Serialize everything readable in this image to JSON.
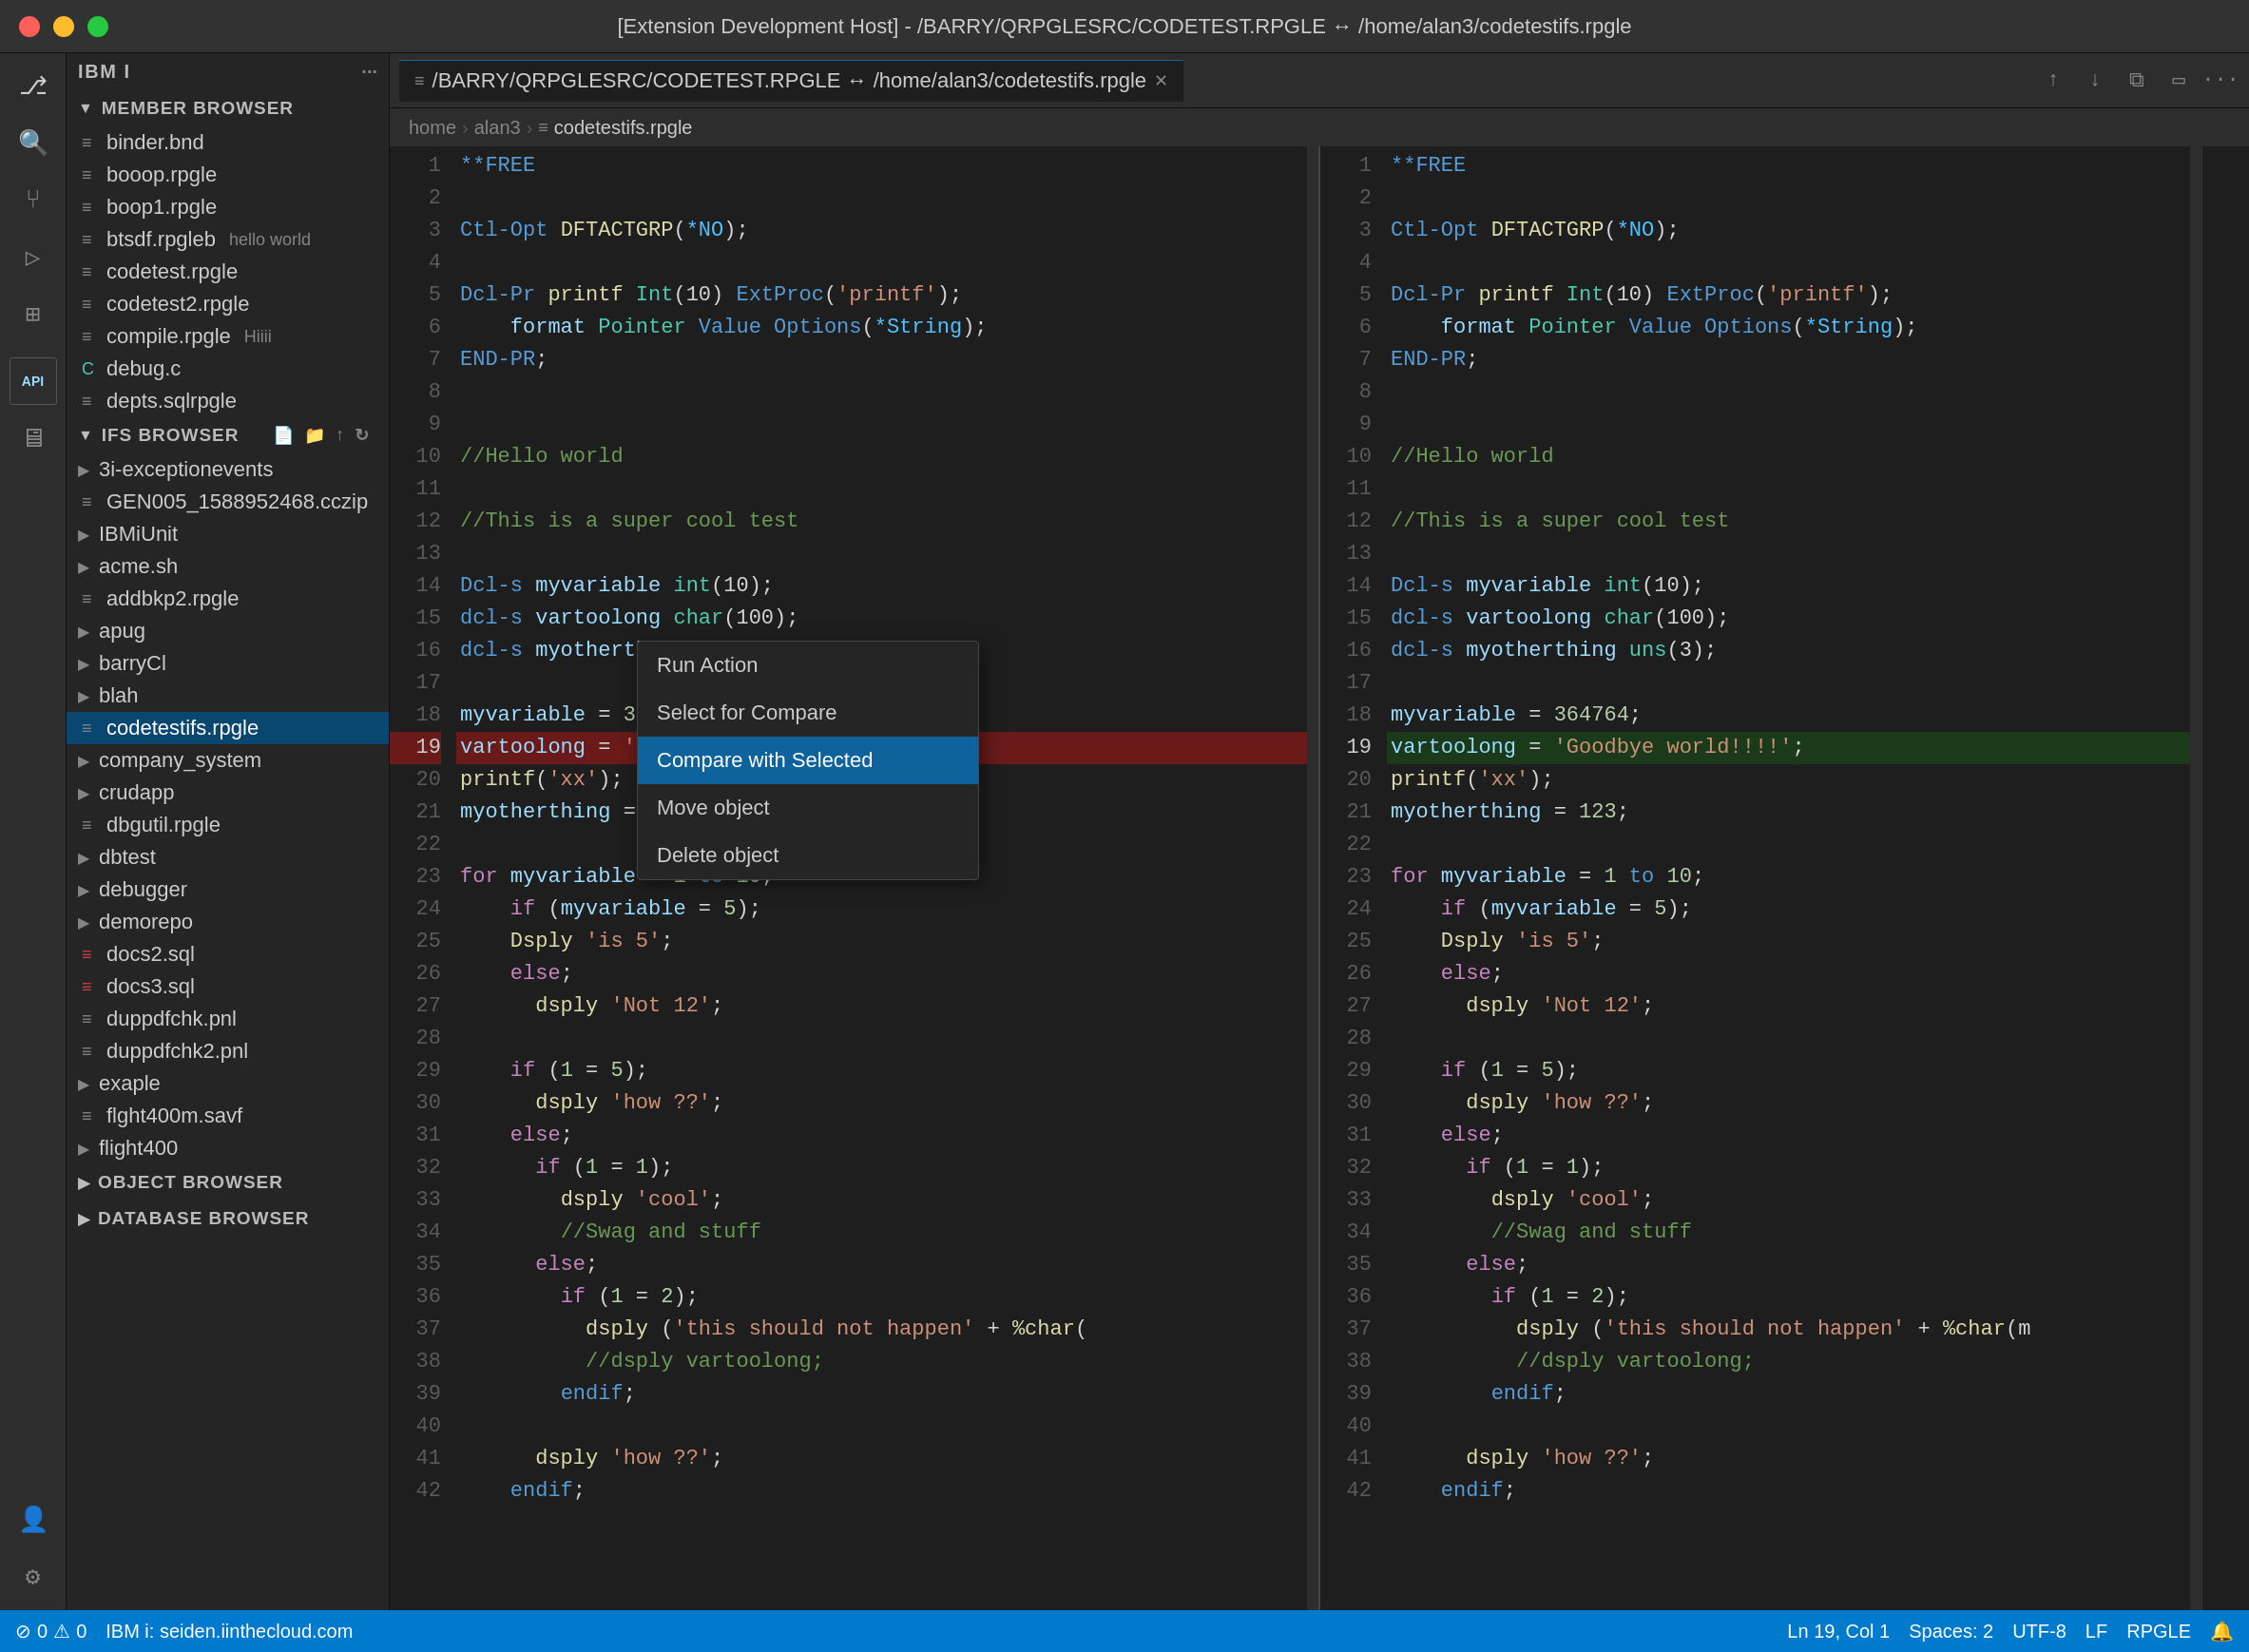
{
  "titleBar": {
    "text": "[Extension Development Host] - /BARRY/QRPGLESRC/CODETEST.RPGLE ↔ /home/alan3/codetestifs.rpgle"
  },
  "sidebar": {
    "topTitle": "IBM I",
    "memberBrowser": {
      "label": "MEMBER BROWSER",
      "items": [
        {
          "name": "binder.bnd",
          "icon": "≡",
          "badge": ""
        },
        {
          "name": "booop.rpgle",
          "icon": "≡",
          "badge": ""
        },
        {
          "name": "boop1.rpgle",
          "icon": "≡",
          "badge": ""
        },
        {
          "name": "btsdf.rpgleb",
          "icon": "≡",
          "badge": "hello world"
        },
        {
          "name": "codetest.rpgle",
          "icon": "≡",
          "badge": ""
        },
        {
          "name": "codetest2.rpgle",
          "icon": "≡",
          "badge": ""
        },
        {
          "name": "compile.rpgle",
          "icon": "≡",
          "badge": "Hiiii"
        },
        {
          "name": "debug.c",
          "icon": "C",
          "badge": ""
        },
        {
          "name": "depts.sqlrpgle",
          "icon": "≡",
          "badge": ""
        }
      ]
    },
    "ifsBrowser": {
      "label": "IFS BROWSER",
      "items": [
        {
          "name": "3i-exceptionevents",
          "icon": "▶",
          "type": "folder"
        },
        {
          "name": "GEN005_1588952468.cczip",
          "icon": "≡",
          "type": "file"
        },
        {
          "name": "IBMiUnit",
          "icon": "▶",
          "type": "folder"
        },
        {
          "name": "acme.sh",
          "icon": "▶",
          "type": "folder"
        },
        {
          "name": "addbkp2.rpgle",
          "icon": "≡",
          "type": "file"
        },
        {
          "name": "apug",
          "icon": "▶",
          "type": "folder"
        },
        {
          "name": "barryCl",
          "icon": "▶",
          "type": "folder"
        },
        {
          "name": "blah",
          "icon": "▶",
          "type": "folder"
        },
        {
          "name": "codetestifs.rpgle",
          "icon": "≡",
          "type": "file",
          "selected": true
        },
        {
          "name": "company_system",
          "icon": "▶",
          "type": "folder"
        },
        {
          "name": "crudapp",
          "icon": "▶",
          "type": "folder"
        },
        {
          "name": "dbgutil.rpgle",
          "icon": "≡",
          "type": "file"
        },
        {
          "name": "dbtest",
          "icon": "▶",
          "type": "folder"
        },
        {
          "name": "debugger",
          "icon": "▶",
          "type": "folder"
        },
        {
          "name": "demorepo",
          "icon": "▶",
          "type": "folder"
        },
        {
          "name": "docs2.sql",
          "icon": "≡",
          "type": "file",
          "red": true
        },
        {
          "name": "docs3.sql",
          "icon": "≡",
          "type": "file",
          "red": true
        },
        {
          "name": "duppdfchk.pnl",
          "icon": "≡",
          "type": "file"
        },
        {
          "name": "duppdfchk2.pnl",
          "icon": "≡",
          "type": "file"
        },
        {
          "name": "exaple",
          "icon": "▶",
          "type": "folder"
        },
        {
          "name": "flght400m.savf",
          "icon": "≡",
          "type": "file"
        },
        {
          "name": "flight400",
          "icon": "▶",
          "type": "folder"
        }
      ]
    },
    "objectBrowser": {
      "label": "OBJECT BROWSER"
    },
    "databaseBrowser": {
      "label": "DATABASE BROWSER"
    }
  },
  "tabBar": {
    "tabLabel": "/BARRY/QRPGLESRC/CODETEST.RPGLE ↔ /home/alan3/codetestifs.rpgle",
    "breadcrumb": {
      "home": "home",
      "alan3": "alan3",
      "file": "codetestifs.rpgle"
    }
  },
  "contextMenu": {
    "items": [
      {
        "id": "run-action",
        "label": "Run Action",
        "active": false
      },
      {
        "id": "select-for-compare",
        "label": "Select for Compare",
        "active": false
      },
      {
        "id": "compare-with-selected",
        "label": "Compare with Selected",
        "active": true
      },
      {
        "id": "move-object",
        "label": "Move object",
        "active": false
      },
      {
        "id": "delete-object",
        "label": "Delete object",
        "active": false
      }
    ]
  },
  "leftEditor": {
    "lines": [
      {
        "num": 1,
        "code": "**FREE",
        "type": "keyword"
      },
      {
        "num": 2,
        "code": ""
      },
      {
        "num": 3,
        "code": "Ctl-Opt DFTACTGRP(*NO);"
      },
      {
        "num": 4,
        "code": ""
      },
      {
        "num": 5,
        "code": "Dcl-Pr printf Int(10) ExtProc('printf');"
      },
      {
        "num": 6,
        "code": "    format Pointer Value Options(*String);"
      },
      {
        "num": 7,
        "code": "END-PR;"
      },
      {
        "num": 8,
        "code": ""
      },
      {
        "num": 9,
        "code": ""
      },
      {
        "num": 10,
        "code": "//Hello world"
      },
      {
        "num": 11,
        "code": ""
      },
      {
        "num": 12,
        "code": "//This is a super cool test"
      },
      {
        "num": 13,
        "code": ""
      },
      {
        "num": 14,
        "code": "Dcl-s myvariable int(10);"
      },
      {
        "num": 15,
        "code": "dcl-s vartoolong char(100);"
      },
      {
        "num": 16,
        "code": "dcl-s myotherthing uns(3);"
      },
      {
        "num": 17,
        "code": ""
      },
      {
        "num": 18,
        "code": "myvariable = 364764;"
      },
      {
        "num": 19,
        "code": "vartoolong = 'Hello world!!!!';",
        "highlight": true
      },
      {
        "num": 20,
        "code": "printf('xx');"
      },
      {
        "num": 21,
        "code": "myotherthing = 123;"
      },
      {
        "num": 22,
        "code": ""
      },
      {
        "num": 23,
        "code": "for myvariable = 1 to 10;"
      },
      {
        "num": 24,
        "code": "    if (myvariable = 5);"
      },
      {
        "num": 25,
        "code": "    Dsply 'is 5';"
      },
      {
        "num": 26,
        "code": "    else;"
      },
      {
        "num": 27,
        "code": "      dsply 'Not 12';"
      },
      {
        "num": 28,
        "code": ""
      },
      {
        "num": 29,
        "code": "    if (1 = 5);"
      },
      {
        "num": 30,
        "code": "      dsply 'how ??';"
      },
      {
        "num": 31,
        "code": "    else;"
      },
      {
        "num": 32,
        "code": "      if (1 = 1);"
      },
      {
        "num": 33,
        "code": "        dsply 'cool';"
      },
      {
        "num": 34,
        "code": "        //Swag and stuff"
      },
      {
        "num": 35,
        "code": "      else;"
      },
      {
        "num": 36,
        "code": "        if (1 = 2);"
      },
      {
        "num": 37,
        "code": "          dsply ('this should not happen' + %char("
      },
      {
        "num": 38,
        "code": "          //dsply vartoolong;"
      },
      {
        "num": 39,
        "code": "        endif;"
      },
      {
        "num": 40,
        "code": ""
      },
      {
        "num": 41,
        "code": "      dsply 'how ??';"
      },
      {
        "num": 42,
        "code": "    endif;"
      }
    ]
  },
  "rightEditor": {
    "lines": [
      {
        "num": 1,
        "code": "**FREE",
        "type": "keyword"
      },
      {
        "num": 2,
        "code": ""
      },
      {
        "num": 3,
        "code": "Ctl-Opt DFTACTGRP(*NO);"
      },
      {
        "num": 4,
        "code": ""
      },
      {
        "num": 5,
        "code": "Dcl-Pr printf Int(10) ExtProc('printf');"
      },
      {
        "num": 6,
        "code": "    format Pointer Value Options(*String);"
      },
      {
        "num": 7,
        "code": "END-PR;"
      },
      {
        "num": 8,
        "code": ""
      },
      {
        "num": 9,
        "code": ""
      },
      {
        "num": 10,
        "code": "//Hello world"
      },
      {
        "num": 11,
        "code": ""
      },
      {
        "num": 12,
        "code": "//This is a super cool test"
      },
      {
        "num": 13,
        "code": ""
      },
      {
        "num": 14,
        "code": "Dcl-s myvariable int(10);"
      },
      {
        "num": 15,
        "code": "dcl-s vartoolong char(100);"
      },
      {
        "num": 16,
        "code": "dcl-s myotherthing uns(3);"
      },
      {
        "num": 17,
        "code": ""
      },
      {
        "num": 18,
        "code": "myvariable = 364764;"
      },
      {
        "num": 19,
        "code": "vartoolong = 'Goodbye world!!!!';",
        "diffAdded": true
      },
      {
        "num": 20,
        "code": "printf('xx');"
      },
      {
        "num": 21,
        "code": "myotherthing = 123;"
      },
      {
        "num": 22,
        "code": ""
      },
      {
        "num": 23,
        "code": "for myvariable = 1 to 10;"
      },
      {
        "num": 24,
        "code": "    if (myvariable = 5);"
      },
      {
        "num": 25,
        "code": "    Dsply 'is 5';"
      },
      {
        "num": 26,
        "code": "    else;"
      },
      {
        "num": 27,
        "code": "      dsply 'Not 12';"
      },
      {
        "num": 28,
        "code": ""
      },
      {
        "num": 29,
        "code": "    if (1 = 5);"
      },
      {
        "num": 30,
        "code": "      dsply 'how ??';"
      },
      {
        "num": 31,
        "code": "    else;"
      },
      {
        "num": 32,
        "code": "      if (1 = 1);"
      },
      {
        "num": 33,
        "code": "        dsply 'cool';"
      },
      {
        "num": 34,
        "code": "        //Swag and stuff"
      },
      {
        "num": 35,
        "code": "      else;"
      },
      {
        "num": 36,
        "code": "        if (1 = 2);"
      },
      {
        "num": 37,
        "code": "          dsply ('this should not happen' + %char(m"
      },
      {
        "num": 38,
        "code": "          //dsply vartoolong;"
      },
      {
        "num": 39,
        "code": "        endif;"
      },
      {
        "num": 40,
        "code": ""
      },
      {
        "num": 41,
        "code": "      dsply 'how ??';"
      },
      {
        "num": 42,
        "code": "    endif;"
      }
    ]
  },
  "statusBar": {
    "errors": "0",
    "warnings": "0",
    "host": "IBM i: seiden.iinthecloud.com",
    "position": "Ln 19, Col 1",
    "spaces": "Spaces: 2",
    "encoding": "UTF-8",
    "lineEnding": "LF",
    "language": "RPGLE"
  }
}
